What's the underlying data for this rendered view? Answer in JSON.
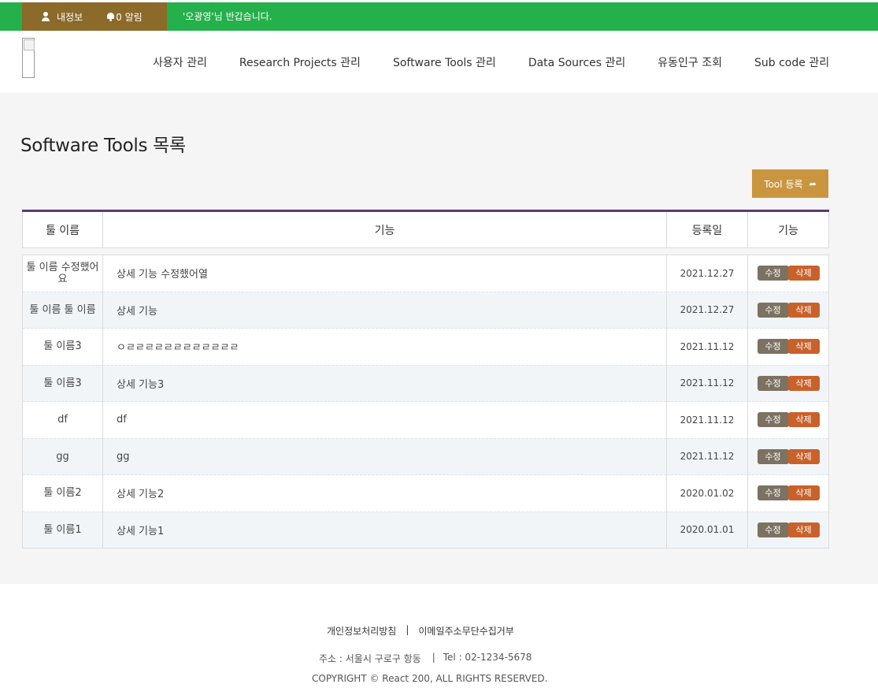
{
  "topbar": {
    "my_info": "내정보",
    "alarm": "0 알림",
    "welcome": "'오광영'님 반갑습니다."
  },
  "nav": [
    "사용자 관리",
    "Research Projects 관리",
    "Software Tools 관리",
    "Data Sources 관리",
    "유동인구 조회",
    "Sub code 관리"
  ],
  "page": {
    "title": "Software Tools 목록",
    "register_button": "Tool 등록"
  },
  "table": {
    "headers": [
      "툴 이름",
      "기능",
      "등록일",
      "기능"
    ],
    "edit_label": "수정",
    "delete_label": "삭제",
    "rows": [
      {
        "name": "툴 이름 수정했어요",
        "func": "상세 기능 수정했어열",
        "date": "2021.12.27"
      },
      {
        "name": "툴 이름 툴 이름",
        "func": "상세 기능",
        "date": "2021.12.27"
      },
      {
        "name": "툴 이름3",
        "func": "ㅇㄹㄹㄹㄹㄹㄹㄹㄹㄹㄹㄹㄹ",
        "date": "2021.11.12"
      },
      {
        "name": "툴 이름3",
        "func": "상세 기능3",
        "date": "2021.11.12"
      },
      {
        "name": "df",
        "func": "df",
        "date": "2021.11.12"
      },
      {
        "name": "gg",
        "func": "gg",
        "date": "2021.11.12"
      },
      {
        "name": "툴 이름2",
        "func": "상세 기능2",
        "date": "2020.01.02"
      },
      {
        "name": "툴 이름1",
        "func": "상세 기능1",
        "date": "2020.01.01"
      }
    ]
  },
  "footer": {
    "privacy": "개인정보처리방침",
    "separator": "|",
    "email_refusal": "이메일주소무단수집거부",
    "address": "주소 : 서울시 구로구 항동",
    "tel": "Tel : 02-1234-5678",
    "copyright": "COPYRIGHT © React 200, ALL RIGHTS RESERVED."
  },
  "colors": {
    "topbar": "#24b04b",
    "userbox": "#8b6a2a",
    "register_button": "#c9953f",
    "table_top_border": "#5b3a78",
    "edit_button": "#7b7262",
    "delete_button": "#c9612a"
  }
}
